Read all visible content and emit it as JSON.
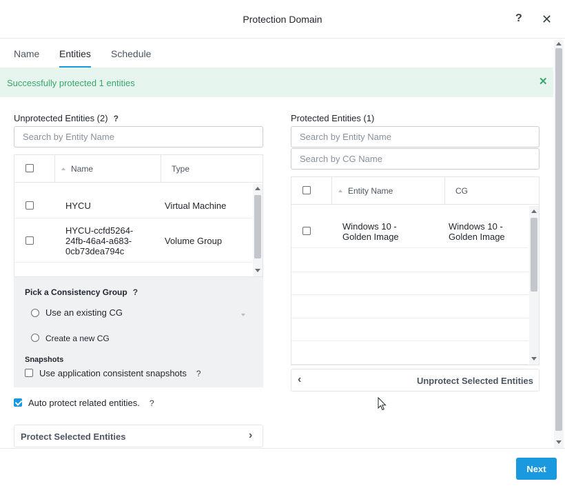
{
  "dialog": {
    "title": "Protection Domain",
    "help_icon": "question-icon",
    "close_icon": "close-icon"
  },
  "tabs": [
    {
      "label": "Name",
      "active": false
    },
    {
      "label": "Entities",
      "active": true
    },
    {
      "label": "Schedule",
      "active": false
    }
  ],
  "banner": {
    "message": "Successfully protected 1 entities",
    "close_icon": "close-icon",
    "color": "#39a66b"
  },
  "unprotected": {
    "title": "Unprotected Entities (2)",
    "help": "?",
    "search_placeholder": "Search by Entity Name",
    "columns": [
      "Name",
      "Type"
    ],
    "rows": [
      {
        "name": "HYCU",
        "type": "Virtual Machine"
      },
      {
        "name_lines": [
          "HYCU-ccfd5264-",
          "24fb-46a4-a683-",
          "0cb73dea794c"
        ],
        "type": "Volume Group"
      }
    ],
    "consistency": {
      "title": "Pick a Consistency Group",
      "help": "?",
      "option_existing": "Use an existing CG",
      "option_new": "Create a new CG",
      "snapshots_title": "Snapshots",
      "snapshots_option": "Use application consistent snapshots",
      "snapshots_help": "?"
    },
    "auto_protect": {
      "label": "Auto protect related entities.",
      "help": "?",
      "checked": true
    },
    "protect_button": "Protect Selected Entities"
  },
  "protected": {
    "title": "Protected Entities (1)",
    "search_placeholder": "Search by Entity Name",
    "cg_search_placeholder": "Search by CG Name",
    "columns": [
      "Entity Name",
      "CG"
    ],
    "rows": [
      {
        "name_lines": [
          "Windows 10 -",
          "Golden Image"
        ],
        "cg_lines": [
          "Windows 10 -",
          "Golden Image"
        ]
      }
    ],
    "unprotect_button": "Unprotect Selected Entities"
  },
  "footer": {
    "next_label": "Next"
  },
  "colors": {
    "accent": "#1b99de",
    "success_bg": "#e6f6ef",
    "success_text": "#39a66b"
  }
}
